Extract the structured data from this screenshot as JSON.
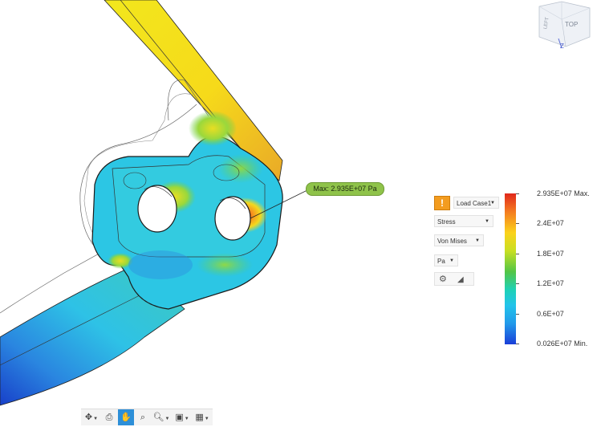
{
  "viewcube": {
    "face_label": "TOP",
    "side_label": "LEFT",
    "axis_label": "Z"
  },
  "callout": {
    "max_label": "Max: 2.935E+07 Pa"
  },
  "result_panel": {
    "warning_symbol": "!",
    "load_case": "Load Case1",
    "result_type": "Stress",
    "stress_type": "Von Mises",
    "units": "Pa",
    "legend_labels": [
      "2.935E+07 Max.",
      "2.4E+07",
      "1.8E+07",
      "1.2E+07",
      "0.6E+07",
      "0.026E+07 Min."
    ],
    "legend_values": [
      29350000.0,
      24000000.0,
      18000000.0,
      12000000.0,
      6000000.0,
      260000.0
    ],
    "max_color": "#e0281c",
    "min_color": "#1a3ed8"
  },
  "toolbar": {
    "items": [
      "orbit-icon",
      "look-at-icon",
      "pan-icon",
      "zoom-window-icon",
      "zoom-icon",
      "display-settings-icon",
      "grid-icon"
    ],
    "active_item": "pan-icon"
  }
}
